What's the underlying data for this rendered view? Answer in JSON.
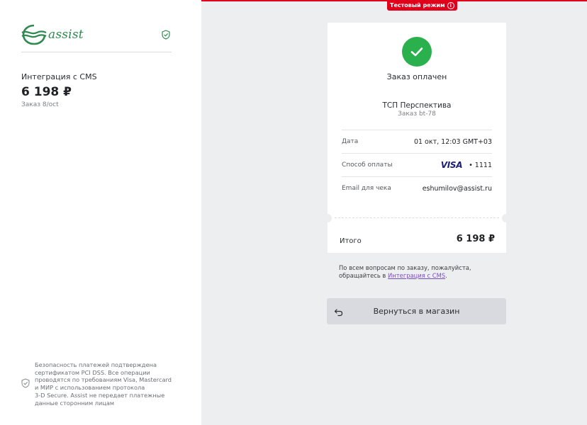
{
  "brand": {
    "logo_text": "assist",
    "logo_color": "#2e8a4f"
  },
  "sidebar": {
    "merchant_label": "Интеграция с CMS",
    "amount": "6 198 ₽",
    "order": "Заказ 8/oct",
    "security": {
      "line1": "Безопасность платежей подтверждена",
      "line2": "сертификатом PCI DSS. Все операции",
      "line3": "проводятся по требованиям Visa, Mastercard",
      "line4": "и МИР с использованием протокола",
      "line5": "3-D Secure. Assist не передает платежные",
      "line6": "данные сторонним лицам"
    }
  },
  "test_mode": {
    "label": "Тестовый режим",
    "info": "i",
    "color": "#e0001b"
  },
  "receipt": {
    "status": "Заказ оплачен",
    "status_color": "#2bb04e",
    "merchant": "ТСП Перспектива",
    "order": "Заказ bt-78",
    "rows": [
      {
        "key": "Дата",
        "value": "01 окт, 12:03 GMT+03"
      },
      {
        "key": "Способ оплаты",
        "card_brand": "VISA",
        "value": "• 1111"
      },
      {
        "key": "Email для чека",
        "value": "eshumilov@assist.ru"
      }
    ],
    "total_label": "Итого",
    "total_value": "6 198 ₽"
  },
  "help": {
    "line1": "По всем вопросам по заказу, пожалуйста,",
    "line2_prefix": "обращайтесь в ",
    "link": "Интеграция с CMS",
    "line2_suffix": "."
  },
  "back_button": {
    "label": "Вернуться в магазин"
  }
}
